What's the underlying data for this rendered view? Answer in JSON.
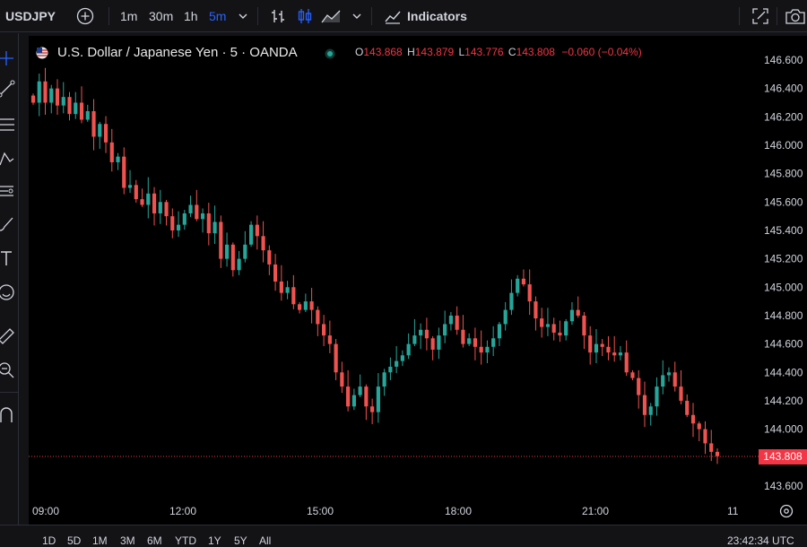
{
  "toolbar": {
    "symbol": "USDJPY",
    "intervals": [
      "1m",
      "30m",
      "1h",
      "5m"
    ],
    "active_interval": "5m",
    "indicators_label": "Indicators",
    "icons": [
      "plus-circle-icon",
      "chevron-down-icon",
      "bar-chart-icon",
      "candles-icon",
      "area-chart-icon",
      "chevron-down-icon",
      "indicators-icon",
      "fullscreen-icon",
      "camera-icon"
    ]
  },
  "legend": {
    "title": "U.S. Dollar / Japanese Yen · 5 · OANDA",
    "open_label": "O",
    "open": "143.868",
    "high_label": "H",
    "high": "143.879",
    "low_label": "L",
    "low": "143.776",
    "close_label": "C",
    "close": "143.808",
    "change": "−0.060 (−0.04%)",
    "up_color": "#26a69a",
    "down_color": "#ef5350"
  },
  "price_axis": {
    "ticks": [
      "146.600",
      "146.400",
      "146.200",
      "146.000",
      "145.800",
      "145.600",
      "145.400",
      "145.200",
      "145.000",
      "144.800",
      "144.600",
      "144.400",
      "144.200",
      "144.000",
      "143.600"
    ],
    "last_price": "143.808"
  },
  "time_axis": {
    "ticks": [
      "09:00",
      "12:00",
      "15:00",
      "18:00",
      "21:00",
      "11"
    ]
  },
  "bottom": {
    "ranges": [
      "1D",
      "5D",
      "1M",
      "3M",
      "6M",
      "YTD",
      "1Y",
      "5Y",
      "All"
    ],
    "clock": "23:42:34 UTC"
  },
  "left_tools": [
    "crosshair-icon",
    "trend-line-icon",
    "fib-icon",
    "pattern-icon",
    "forecast-icon",
    "brush-icon",
    "text-icon",
    "emoji-icon",
    "ruler-icon",
    "zoom-icon",
    "magnet-icon"
  ],
  "chart_data": {
    "type": "candlestick",
    "symbol": "USDJPY",
    "interval": "5",
    "ylim": [
      143.5,
      146.7
    ],
    "last": 143.808,
    "series": [
      {
        "values": [
          146.3,
          146.45,
          146.3,
          146.4,
          146.28,
          146.34,
          146.22,
          146.3,
          146.18,
          146.24,
          146.06,
          146.15,
          146.02,
          145.88,
          145.92,
          145.7,
          145.72,
          145.62,
          145.58,
          145.66,
          145.52,
          145.6,
          145.5,
          145.4,
          145.44,
          145.52,
          145.58,
          145.48,
          145.52,
          145.38,
          145.46,
          145.2,
          145.3,
          145.12,
          145.2,
          145.3,
          145.44,
          145.36,
          145.26,
          145.16,
          145.04,
          144.96,
          145.0,
          144.88,
          144.84,
          144.9,
          144.84,
          144.74,
          144.66,
          144.6,
          144.4,
          144.3,
          144.16,
          144.24,
          144.3,
          144.16,
          144.12,
          144.3,
          144.4,
          144.44,
          144.48,
          144.52,
          144.6,
          144.66,
          144.7,
          144.64,
          144.56,
          144.66,
          144.74,
          144.8,
          144.7,
          144.6,
          144.64,
          144.58,
          144.54,
          144.58,
          144.64,
          144.74,
          144.84,
          144.96,
          145.06,
          145.02,
          144.9,
          144.78,
          144.72,
          144.74,
          144.68,
          144.66,
          144.76,
          144.84,
          144.8,
          144.66,
          144.54,
          144.6,
          144.58,
          144.54,
          144.52,
          144.54,
          144.4,
          144.36,
          144.24,
          144.1,
          144.16,
          144.3,
          144.38,
          144.4,
          144.3,
          144.2,
          144.1,
          144.04,
          144.0,
          143.9,
          143.84,
          143.81
        ]
      }
    ]
  }
}
